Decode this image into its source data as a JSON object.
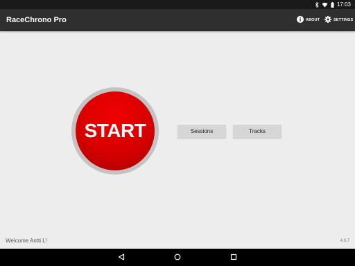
{
  "status_bar": {
    "time": "17:03",
    "icons": [
      "bluetooth-icon",
      "wifi-icon",
      "battery-icon"
    ]
  },
  "action_bar": {
    "title": "RaceChrono Pro",
    "about_label": "ABOUT",
    "about_icon": "info-icon",
    "settings_label": "SETTINGS",
    "settings_icon": "gear-icon"
  },
  "main": {
    "start_label": "START",
    "sessions_label": "Sessions",
    "tracks_label": "Tracks"
  },
  "footer": {
    "welcome": "Welcome Antti L!",
    "version": "4.0.7"
  },
  "nav_bar": {
    "icons": [
      "back-icon",
      "home-icon",
      "recents-icon"
    ]
  },
  "colors": {
    "action_bar": "#2f2f2f",
    "start_red": "#d70000",
    "start_ring": "#c3c3c3",
    "background": "#ededed"
  }
}
